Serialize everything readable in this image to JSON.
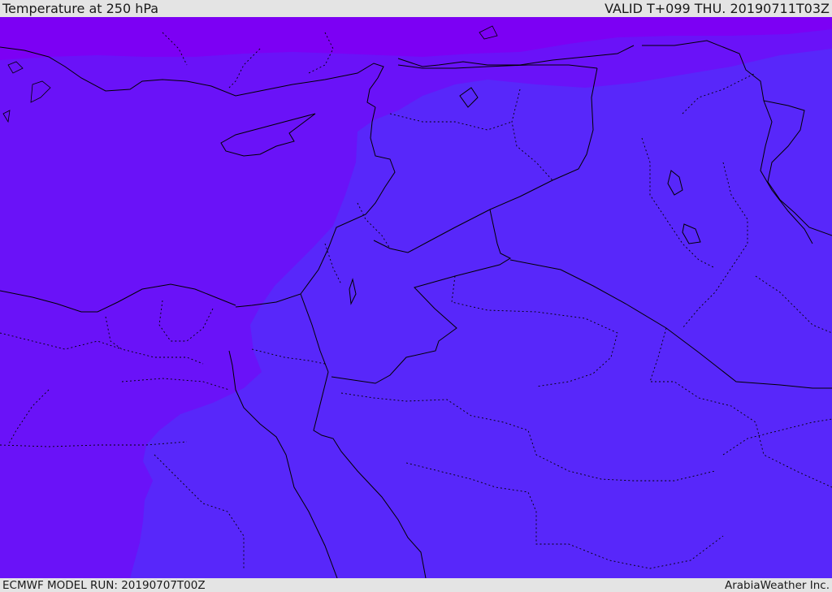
{
  "header": {
    "title": "Temperature at 250 hPa",
    "valid": "VALID T+099 THU. 20190711T03Z"
  },
  "footer": {
    "model_run": "ECMWF MODEL RUN: 20190707T00Z",
    "credit": "ArabiaWeather Inc."
  },
  "colors": {
    "band_coldest": "#7c00f4",
    "band_cold": "#6a12f8",
    "band_mid": "#5827fa",
    "land_border": "#000000",
    "chrome_bg": "#e4e4e4"
  }
}
